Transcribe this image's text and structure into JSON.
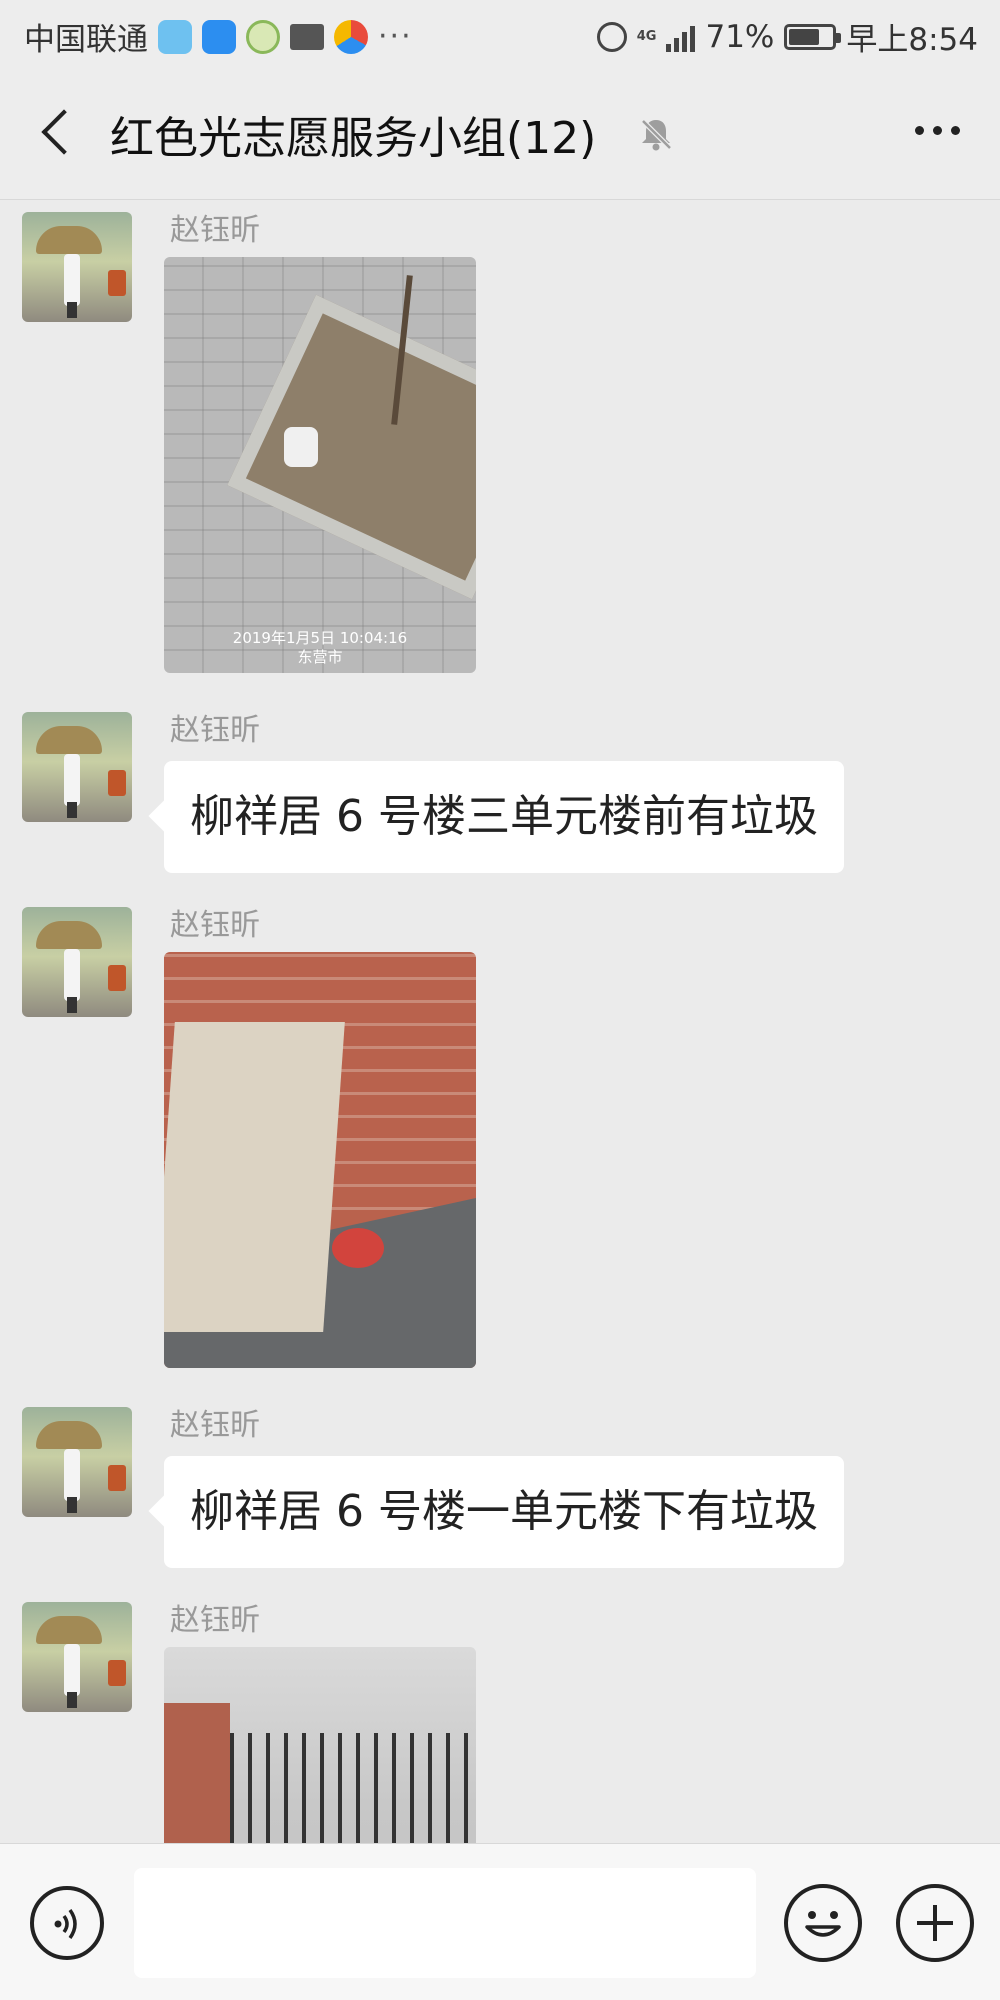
{
  "status_bar": {
    "carrier": "中国联通",
    "battery": "71%",
    "battery_level": 0.71,
    "time": "早上8:54",
    "network": "4G",
    "dots": "···"
  },
  "header": {
    "title": "红色光志愿服务小组(12)",
    "muted": true
  },
  "messages": [
    {
      "type": "image",
      "sender": "赵钰昕",
      "image_stamp_line1": "2019年1月5日 10:04:16",
      "image_stamp_line2": "东营市"
    },
    {
      "type": "text",
      "sender": "赵钰昕",
      "text": "柳祥居 6 号楼三单元楼前有垃圾"
    },
    {
      "type": "image",
      "sender": "赵钰昕"
    },
    {
      "type": "text",
      "sender": "赵钰昕",
      "text": "柳祥居 6 号楼一单元楼下有垃圾"
    },
    {
      "type": "image",
      "sender": "赵钰昕"
    }
  ],
  "input_bar": {
    "placeholder": ""
  },
  "icons": {
    "back": "chevron-left-icon",
    "mute": "bell-off-icon",
    "more": "more-horizontal-icon",
    "voice": "voice-icon",
    "emoji": "emoji-icon",
    "plus": "plus-icon"
  }
}
